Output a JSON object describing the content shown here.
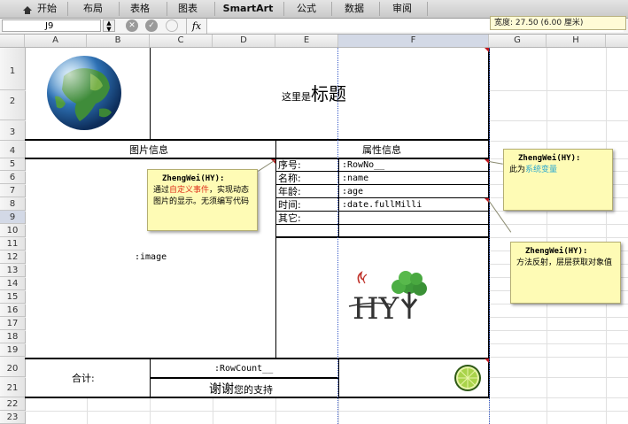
{
  "ribbon": {
    "tabs": [
      "开始",
      "布局",
      "表格",
      "图表",
      "SmartArt",
      "公式",
      "数据",
      "审阅"
    ]
  },
  "tooltip": {
    "width_text": "宽度: 27.50 (6.00 厘米)"
  },
  "formula_bar": {
    "name_box": "J9",
    "fx_label": "fx",
    "cancel_glyph": "✕",
    "enter_glyph": "✓",
    "value": ""
  },
  "columns": [
    "A",
    "B",
    "C",
    "D",
    "E",
    "F",
    "G",
    "H"
  ],
  "rows": [
    "1",
    "2",
    "3",
    "4",
    "5",
    "6",
    "7",
    "8",
    "9",
    "10",
    "11",
    "12",
    "13",
    "14",
    "15",
    "16",
    "17",
    "18",
    "19",
    "20",
    "21",
    "22",
    "23"
  ],
  "sheet": {
    "title_prefix": "这里是",
    "title_main": "标题",
    "image_section_header": "图片信息",
    "attr_section_header": "属性信息",
    "image_placeholder": ":image",
    "attr_labels": [
      "序号:",
      "名称:",
      "年龄:",
      "时间:",
      "其它:"
    ],
    "attr_values": [
      ":RowNo__",
      ":name",
      ":age",
      ":date.fullMilli",
      ""
    ],
    "total_label": "合计:",
    "row_count": ":RowCount__",
    "thanks_big": "谢谢",
    "thanks_small": "您的支持",
    "logo_text": "HY"
  },
  "comments": [
    {
      "author": "ZhengWei(HY):",
      "before": "通过",
      "highlight": "自定义事件",
      "after": "，实现动态图片的显示。无须编写代码",
      "highlight_color": "#e0321c"
    },
    {
      "author": "ZhengWei(HY):",
      "before": "此为",
      "highlight": "系统变量",
      "after": "",
      "highlight_color": "#2aa8cf"
    },
    {
      "author": "ZhengWei(HY):",
      "before": "方法反射，层层获取对象值",
      "highlight": "",
      "after": "",
      "highlight_color": ""
    }
  ],
  "colors": {
    "comment_bg": "#fefbb5",
    "note_marker": "#c0141c",
    "selection_dash": "#3a5cc8"
  }
}
